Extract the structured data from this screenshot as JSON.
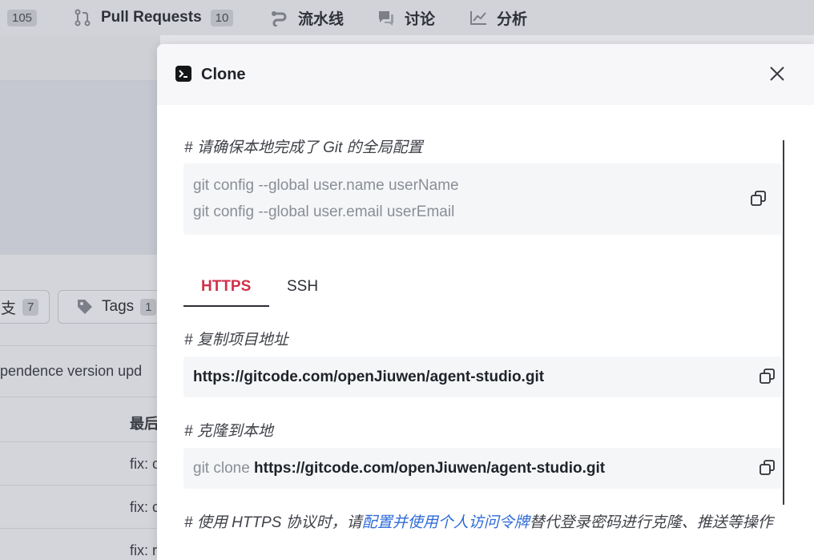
{
  "topnav": {
    "items": [
      {
        "label": "",
        "badge": "105",
        "icon": "count-icon"
      },
      {
        "label": "Pull Requests",
        "badge": "10",
        "icon": "pull-request-icon"
      },
      {
        "label": "流水线",
        "badge": "",
        "icon": "pipeline-icon"
      },
      {
        "label": "讨论",
        "badge": "",
        "icon": "discussion-icon"
      },
      {
        "label": "分析",
        "badge": "",
        "icon": "analytics-icon"
      }
    ]
  },
  "background": {
    "branches_pill": {
      "label": "支",
      "count": "7"
    },
    "tags_pill": {
      "label": "Tags",
      "count": "1"
    },
    "commit_message": "pendence version upd",
    "column_header": "最后",
    "rows": [
      "fix: c",
      "fix: c",
      "fix: r"
    ]
  },
  "modal": {
    "title": "Clone",
    "config_comment": "# 请确保本地完成了 Git 的全局配置",
    "config_lines": [
      "git config --global user.name userName",
      "git config --global user.email userEmail"
    ],
    "tabs": [
      {
        "label": "HTTPS",
        "active": true
      },
      {
        "label": "SSH",
        "active": false
      }
    ],
    "copy_comment": "# 复制项目地址",
    "repo_url": "https://gitcode.com/openJiuwen/agent-studio.git",
    "clone_comment": "# 克隆到本地",
    "clone_prefix": "git clone ",
    "clone_url": "https://gitcode.com/openJiuwen/agent-studio.git",
    "footer_prefix": "# 使用 HTTPS 协议时，请",
    "footer_link": "配置并使用个人访问令牌",
    "footer_suffix": "替代登录密码进行克隆、推送等操作"
  },
  "colors": {
    "active_tab": "#d0304a",
    "link": "#2f6bd8"
  }
}
